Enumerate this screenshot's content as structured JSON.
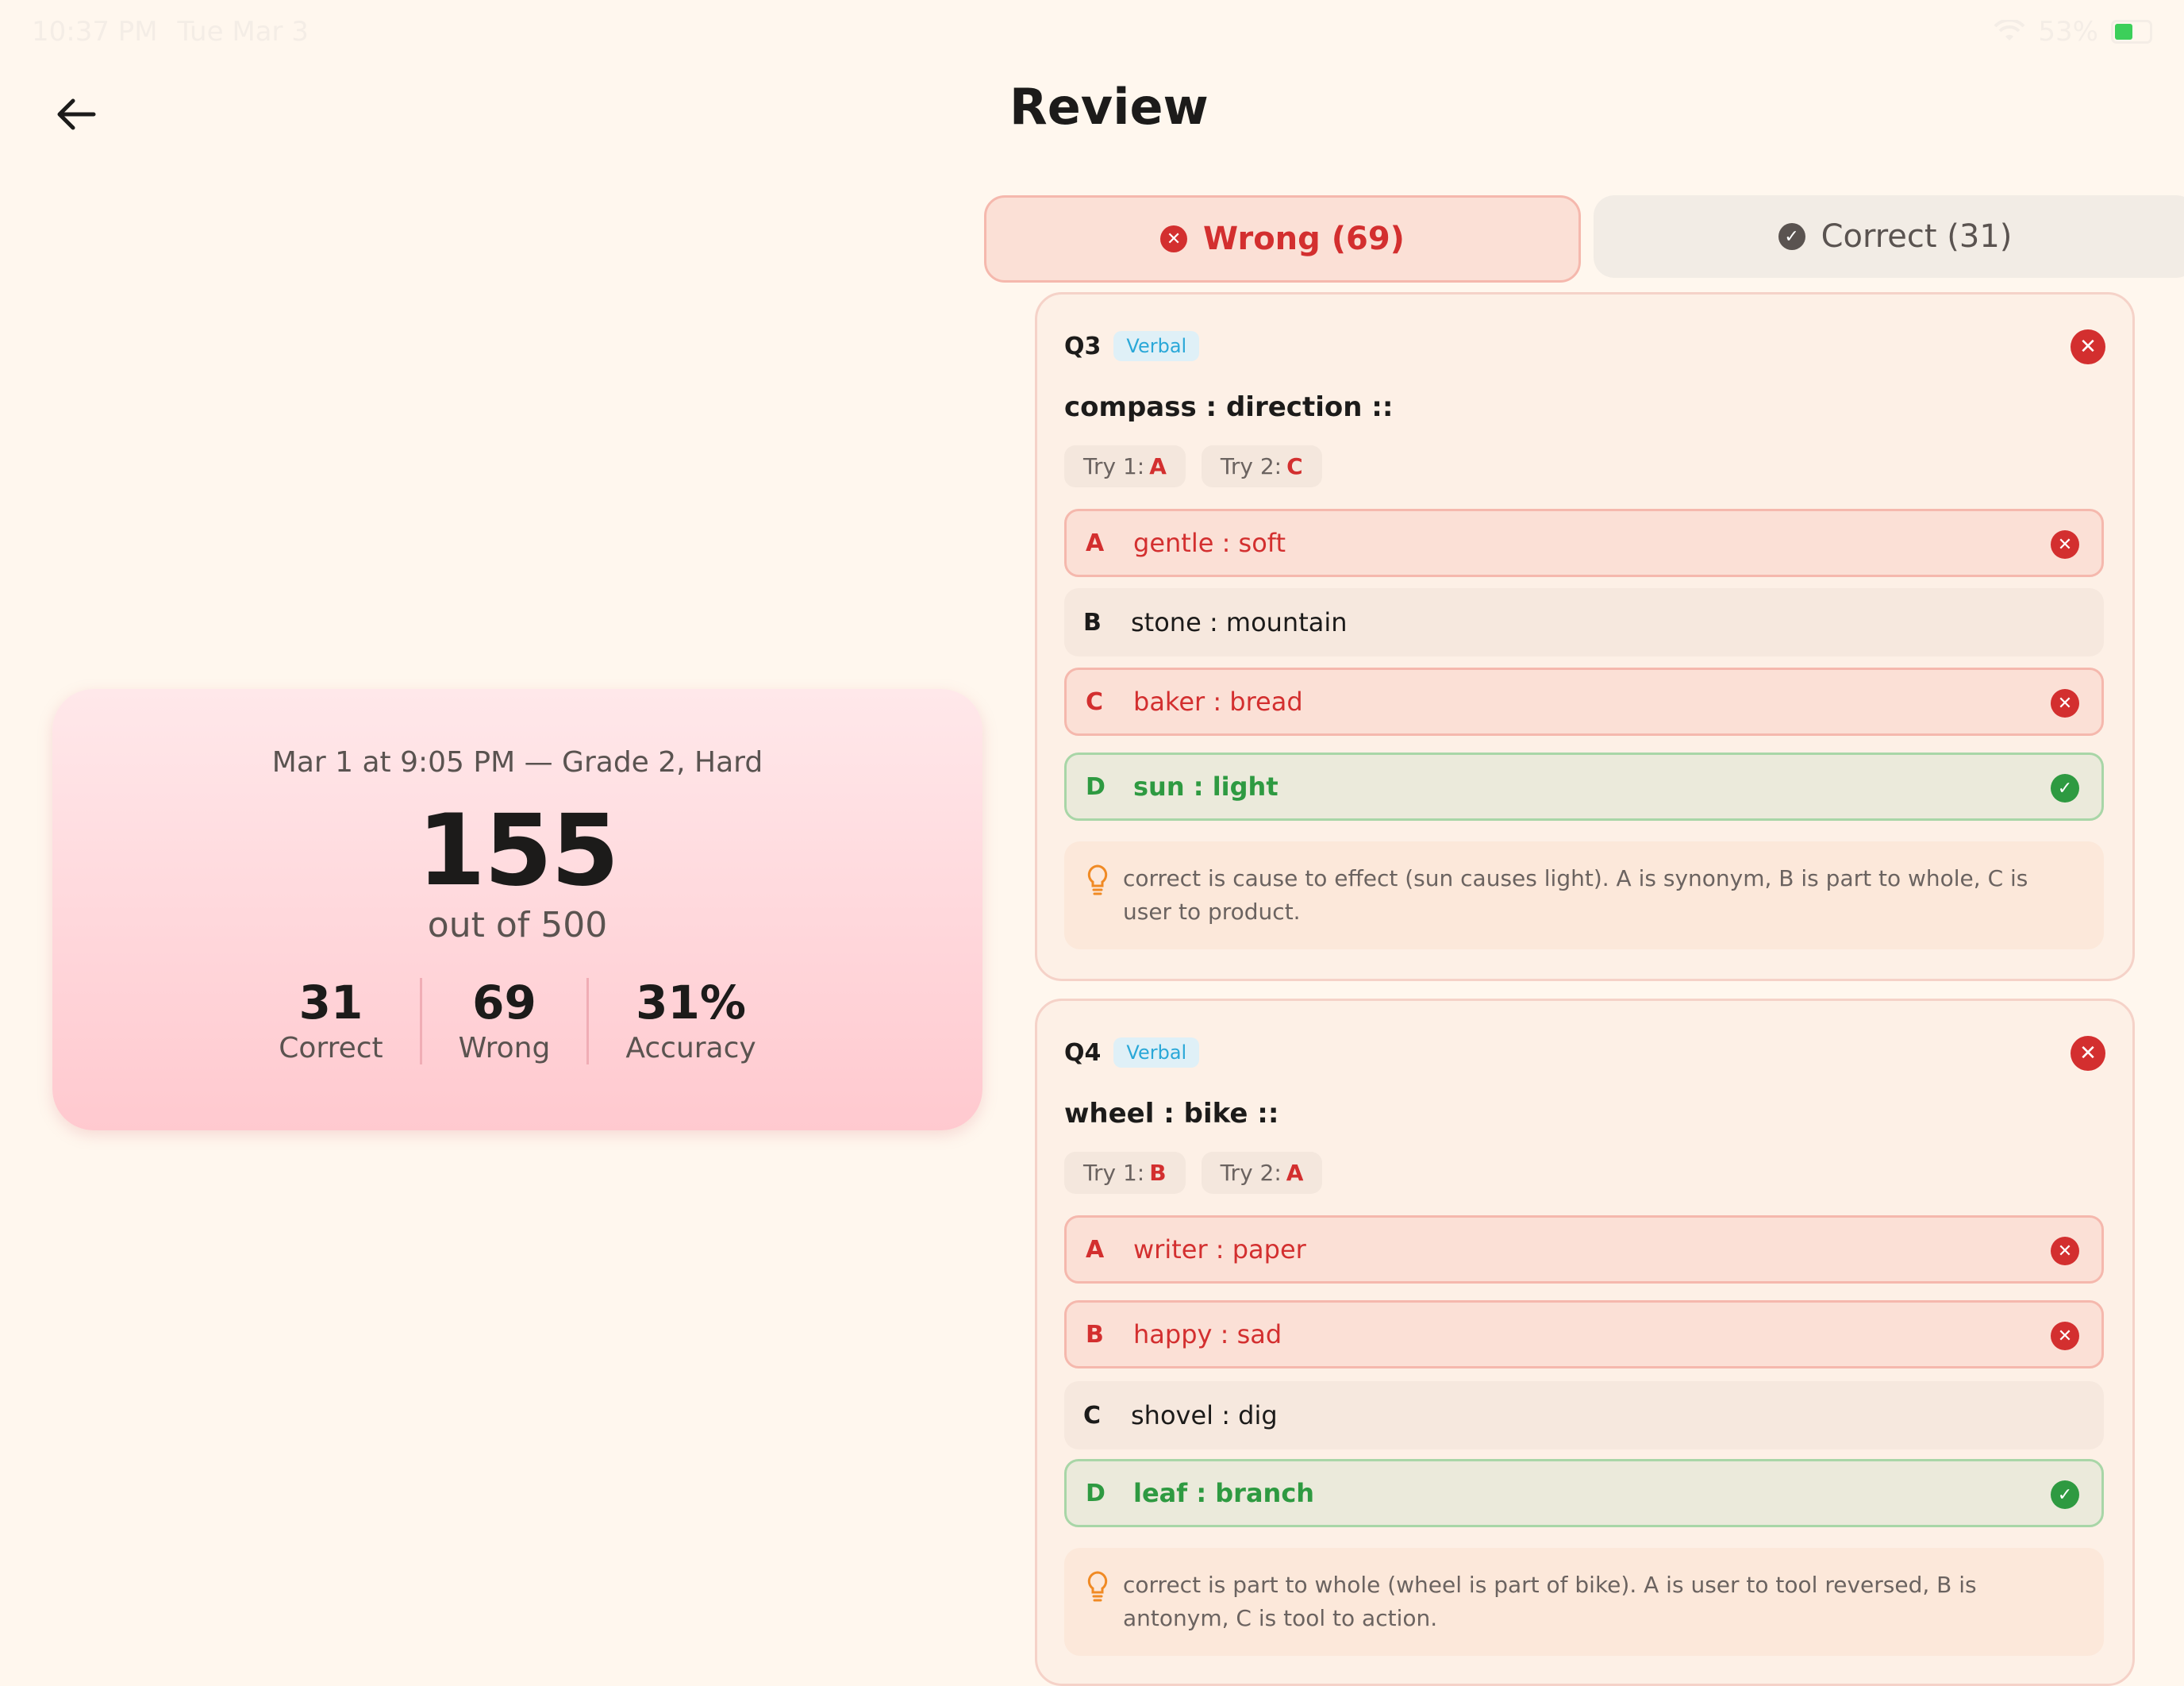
{
  "status_bar": {
    "time": "10:37 PM",
    "date": "Tue Mar 3",
    "battery": "53%"
  },
  "header": {
    "title": "Review",
    "back_icon": "arrow-left-icon"
  },
  "summary": {
    "meta": "Mar 1 at 9:05 PM — Grade 2, Hard",
    "score": "155",
    "out_of": "out of 500",
    "stats": [
      {
        "value": "31",
        "label": "Correct"
      },
      {
        "value": "69",
        "label": "Wrong"
      },
      {
        "value": "31%",
        "label": "Accuracy"
      }
    ]
  },
  "tabs": {
    "wrong": "Wrong (69)",
    "correct": "Correct (31)"
  },
  "questions": [
    {
      "number": "Q3",
      "tag": "Verbal",
      "prompt": "compass : direction ::",
      "tries": [
        {
          "label": "Try 1:",
          "value": "A"
        },
        {
          "label": "Try 2:",
          "value": "C"
        }
      ],
      "options": [
        {
          "letter": "A",
          "text": "gentle : soft"
        },
        {
          "letter": "B",
          "text": "stone : mountain"
        },
        {
          "letter": "C",
          "text": "baker : bread"
        },
        {
          "letter": "D",
          "text": "sun : light"
        }
      ],
      "explanation": "correct is cause to effect (sun causes light). A is synonym, B is part to whole, C is user to product."
    },
    {
      "number": "Q4",
      "tag": "Verbal",
      "prompt": "wheel : bike ::",
      "tries": [
        {
          "label": "Try 1:",
          "value": "B"
        },
        {
          "label": "Try 2:",
          "value": "A"
        }
      ],
      "options": [
        {
          "letter": "A",
          "text": "writer : paper"
        },
        {
          "letter": "B",
          "text": "happy : sad"
        },
        {
          "letter": "C",
          "text": "shovel : dig"
        },
        {
          "letter": "D",
          "text": "leaf : branch"
        }
      ],
      "explanation": "correct is part to whole (wheel is part of bike). A is user to tool reversed, B is antonym, C is tool to action."
    }
  ],
  "colors": {
    "background": "#fff7ee",
    "wrong": "#d32f2f",
    "correct": "#2e9a41",
    "tag": "#2aa8d8"
  }
}
